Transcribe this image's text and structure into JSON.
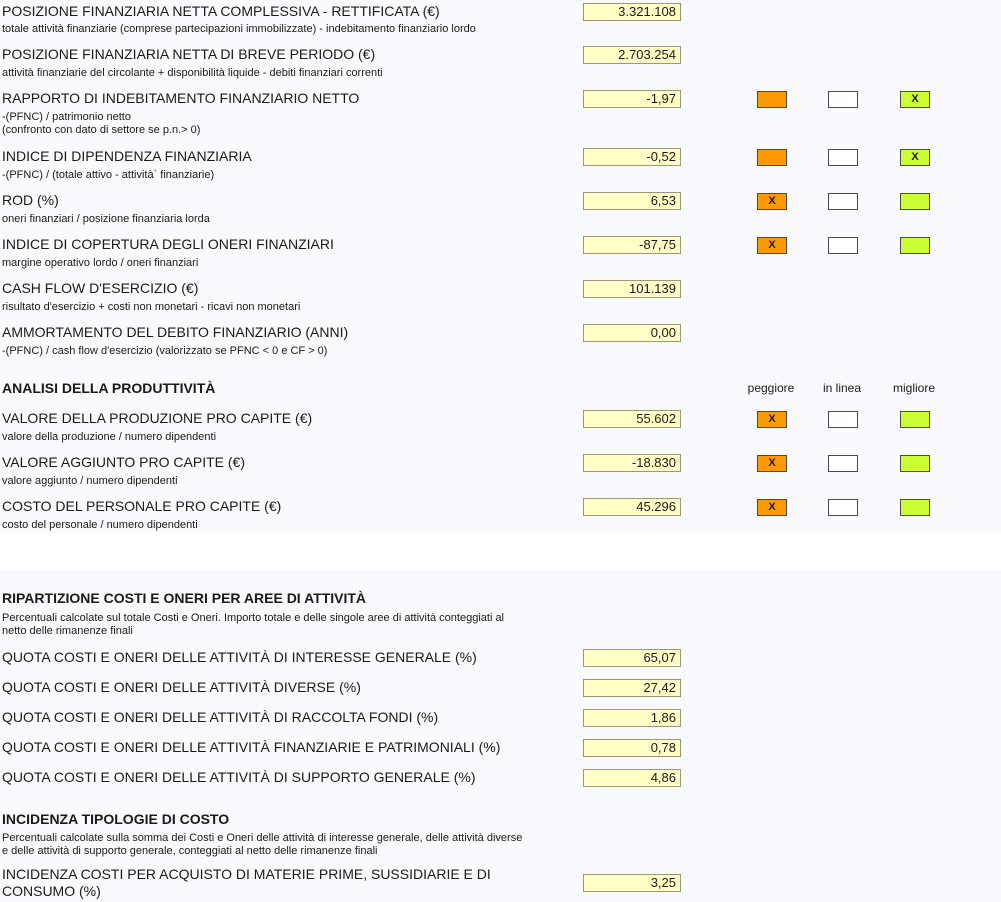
{
  "rows_a": [
    {
      "title": "POSIZIONE FINANZIARIA NETTA COMPLESSIVA - RETTIFICATA (€)",
      "desc": "totale attività finanziarie (comprese partecipazioni immobilizzate) - indebitamento finanziario lordo",
      "value": "3.321.108",
      "indicator": null
    },
    {
      "title": "POSIZIONE FINANZIARIA NETTA DI BREVE PERIODO (€)",
      "desc": "attività finanziarie del circolante + disponibilità liquide - debiti finanziari correnti",
      "value": "2.703.254",
      "indicator": null
    },
    {
      "title": "RAPPORTO DI INDEBITAMENTO FINANZIARIO NETTO",
      "desc": "-(PFNC) / patrimonio netto\n(confronto con dato di settore se p.n.> 0)",
      "value": "-1,97",
      "indicator": {
        "worse": "",
        "inline": "",
        "better": "X"
      }
    },
    {
      "title": "INDICE DI DIPENDENZA FINANZIARIA",
      "desc": "-(PFNC) / (totale attivo - attività` finanziarie)",
      "value": "-0,52",
      "indicator": {
        "worse": "",
        "inline": "",
        "better": "X"
      }
    },
    {
      "title": "ROD (%)",
      "desc": "oneri finanziari / posizione finanziaria lorda",
      "value": "6,53",
      "indicator": {
        "worse": "X",
        "inline": "",
        "better": ""
      }
    },
    {
      "title": "INDICE DI COPERTURA DEGLI ONERI FINANZIARI",
      "desc": "margine operativo lordo / oneri finanziari",
      "value": "-87,75",
      "indicator": {
        "worse": "X",
        "inline": "",
        "better": ""
      }
    },
    {
      "title": "CASH FLOW D'ESERCIZIO (€)",
      "desc": "risultato d'esercizio + costi non monetari - ricavi non monetari",
      "value": "101.139",
      "indicator": null
    },
    {
      "title": "AMMORTAMENTO DEL DEBITO FINANZIARIO (ANNI)",
      "desc": "-(PFNC) / cash flow d'esercizio (valorizzato se PFNC < 0 e CF > 0)",
      "value": "0,00",
      "indicator": null
    }
  ],
  "productivity": {
    "title": "ANALISI DELLA PRODUTTIVITÀ",
    "headers": {
      "worse": "peggiore",
      "inline": "in linea",
      "better": "migliore"
    },
    "rows": [
      {
        "title": "VALORE DELLA PRODUZIONE PRO CAPITE (€)",
        "desc": "valore della produzione / numero dipendenti",
        "value": "55.602",
        "indicator": {
          "worse": "X",
          "inline": "",
          "better": ""
        }
      },
      {
        "title": "VALORE AGGIUNTO PRO CAPITE (€)",
        "desc": "valore aggiunto / numero dipendenti",
        "value": "-18.830",
        "indicator": {
          "worse": "X",
          "inline": "",
          "better": ""
        }
      },
      {
        "title": "COSTO DEL PERSONALE PRO CAPITE (€)",
        "desc": "costo del personale / numero dipendenti",
        "value": "45.296",
        "indicator": {
          "worse": "X",
          "inline": "",
          "better": ""
        }
      }
    ]
  },
  "costs": {
    "title": "RIPARTIZIONE COSTI E ONERI PER AREE DI ATTIVITÀ",
    "desc": "Percentuali calcolate sul totale Costi e Oneri. Importo totale e delle singole aree di attività conteggiati al\nnetto delle rimanenze finali",
    "rows": [
      {
        "title": "QUOTA COSTI E ONERI DELLE ATTIVITÀ DI INTERESSE GENERALE (%)",
        "value": "65,07"
      },
      {
        "title": "QUOTA COSTI E ONERI DELLE ATTIVITÀ DIVERSE (%)",
        "value": "27,42"
      },
      {
        "title": "QUOTA COSTI E ONERI DELLE ATTIVITÀ DI RACCOLTA FONDI (%)",
        "value": "1,86"
      },
      {
        "title": "QUOTA COSTI E ONERI DELLE ATTIVITÀ FINANZIARIE E PATRIMONIALI (%)",
        "value": "0,78"
      },
      {
        "title": "QUOTA COSTI E ONERI DELLE ATTIVITÀ DI SUPPORTO GENERALE (%)",
        "value": "4,86"
      }
    ]
  },
  "incidence": {
    "title": "INCIDENZA TIPOLOGIE DI COSTO",
    "desc": "Percentuali calcolate sulla somma dei Costi e Oneri delle attività di interesse generale, delle attività diverse\ne delle attività di supporto generale, conteggiati al netto delle rimanenze finali",
    "rows": [
      {
        "title_line1": "INCIDENZA COSTI PER ACQUISTO DI MATERIE PRIME, SUSSIDIARIE E DI",
        "title_line2": "CONSUMO (%)",
        "value": "3,25"
      }
    ]
  },
  "colors": {
    "value_bg": "#ffffc6",
    "worse": "#ff9900",
    "inline": "#ffffff",
    "better": "#ccff33"
  }
}
